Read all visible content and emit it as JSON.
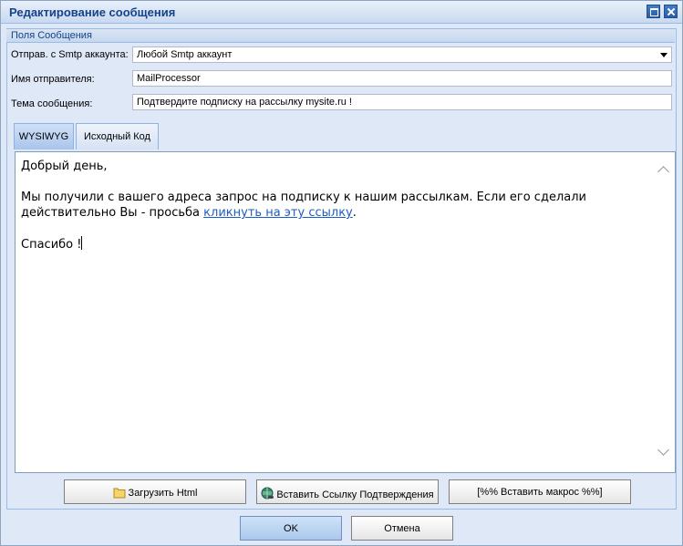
{
  "window": {
    "title": "Редактирование сообщения"
  },
  "fieldset": {
    "legend": "Поля Сообщения"
  },
  "fields": {
    "smtp": {
      "label": "Отправ. с Smtp аккаунта:",
      "value": "Любой Smtp аккаунт"
    },
    "sender": {
      "label": "Имя отправителя:",
      "value": "MailProcessor"
    },
    "subject": {
      "label": "Тема сообщения:",
      "value": "Подтвердите подписку на рассылку mysite.ru !"
    }
  },
  "tabs": [
    {
      "label": "WYSIWYG",
      "active": true
    },
    {
      "label": "Исходный Код",
      "active": false
    }
  ],
  "editor": {
    "greeting": "Добрый день,",
    "body_text": "Мы получили с вашего адреса запрос на подписку к нашим рассылкам. Если его сделали действительно Вы - просьба ",
    "link_text": "кликнуть на эту ссылку",
    "body_end": ".",
    "closing": "Спасибо !"
  },
  "toolbar": {
    "load_html": "Загрузить Html",
    "insert_link": "Вставить Ссылку Подтверждения",
    "insert_macro": "[%% Вставить макрос %%]"
  },
  "footer": {
    "ok": "OK",
    "cancel": "Отмена"
  },
  "colors": {
    "title": "#15428b",
    "link": "#1f5bc6",
    "frame": "#dfe8f6"
  },
  "icons": [
    "maximize-icon",
    "close-icon",
    "folder-icon",
    "globe-link-icon",
    "combo-arrow-icon",
    "scroll-up-icon",
    "scroll-down-icon"
  ]
}
